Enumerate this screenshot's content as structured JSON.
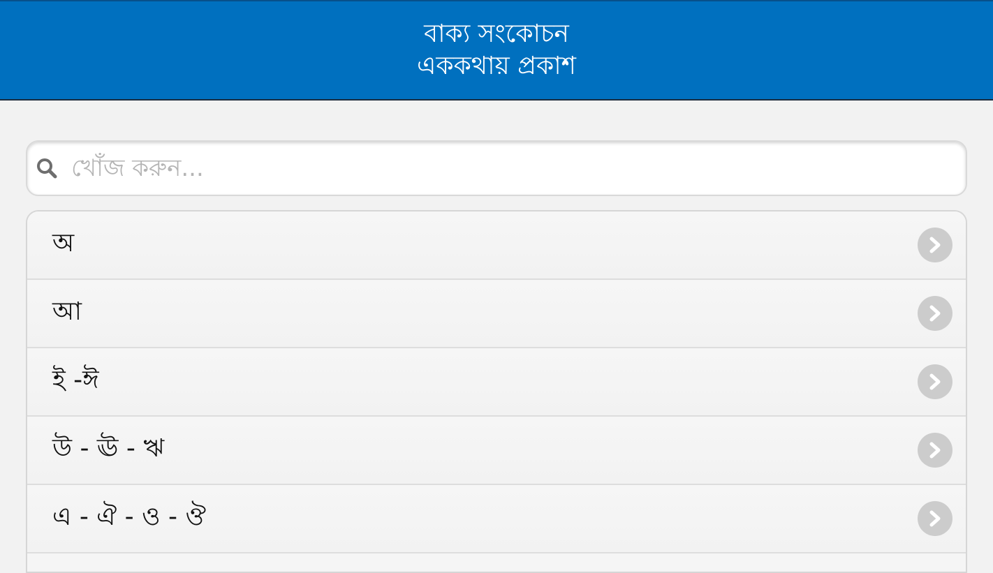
{
  "header": {
    "title_line1": "বাক্য সংকোচন",
    "title_line2": "এককথায় প্রকাশ",
    "background_color": "#0070bf"
  },
  "search": {
    "placeholder": "খোঁজ করুন...",
    "value": "",
    "icon": "search-icon"
  },
  "list": {
    "items": [
      {
        "label": "অ",
        "icon": "chevron-right-icon"
      },
      {
        "label": "আ",
        "icon": "chevron-right-icon"
      },
      {
        "label": "ই -ঈ",
        "icon": "chevron-right-icon"
      },
      {
        "label": "উ - ঊ - ঋ",
        "icon": "chevron-right-icon"
      },
      {
        "label": "এ - ঐ - ও - ঔ",
        "icon": "chevron-right-icon"
      }
    ]
  }
}
